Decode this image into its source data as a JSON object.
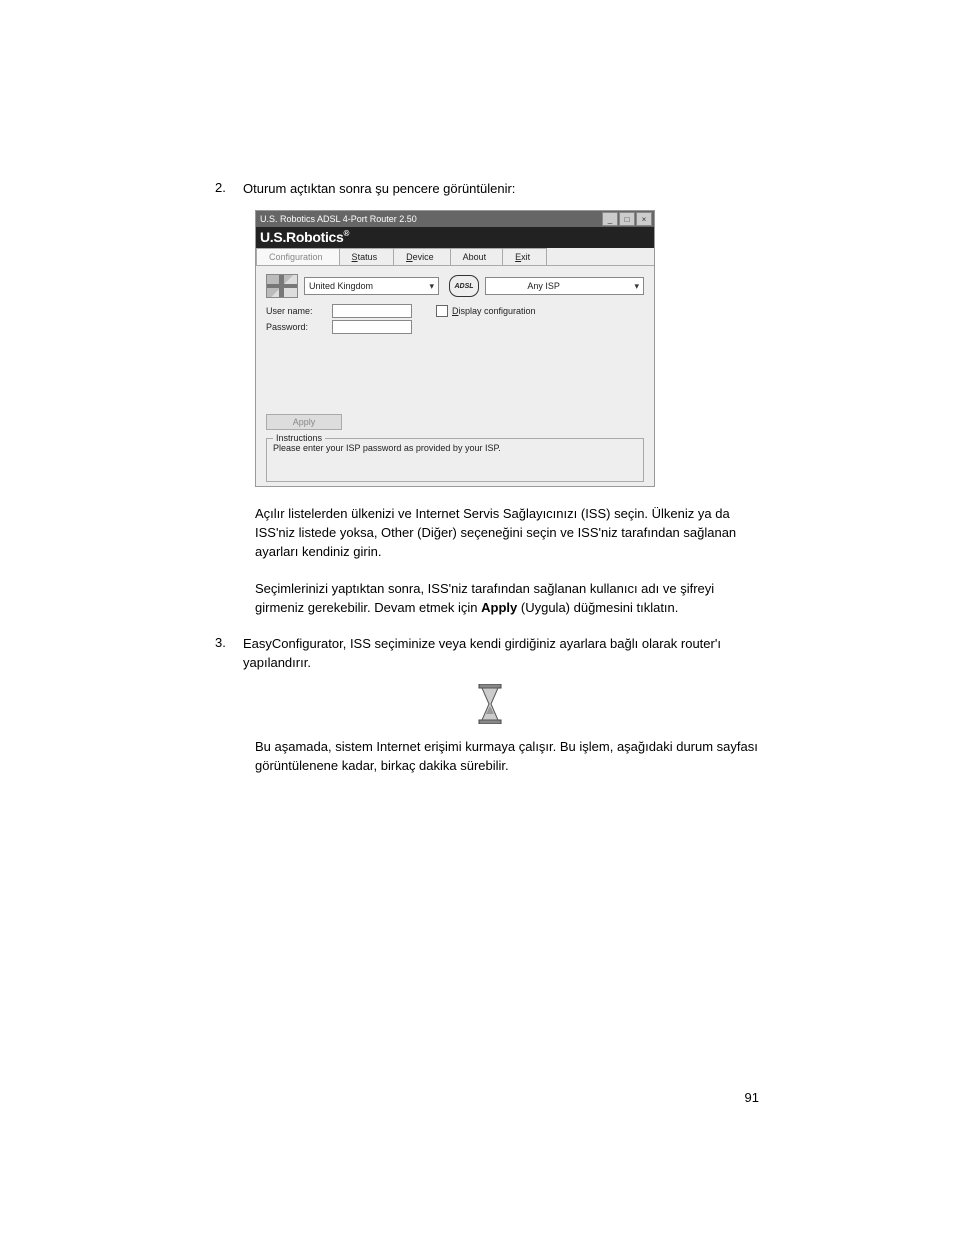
{
  "step2": {
    "num": "2.",
    "lead": "Oturum açtıktan sonra şu pencere görüntülenir:"
  },
  "window": {
    "title": "U.S. Robotics ADSL 4-Port Router 2.50",
    "brand": "U.S.Robotics",
    "brand_suffix": "®",
    "tabs": {
      "configuration": "Configuration",
      "status": "Status",
      "device": "Device",
      "about": "About",
      "exit": "Exit"
    },
    "country_select": "United Kingdom",
    "adsl_badge": "ADSL",
    "isp_select": "Any ISP",
    "labels": {
      "username": "User name:",
      "password": "Password:",
      "display_cfg": "Display configuration"
    },
    "apply": "Apply",
    "instructions_legend": "Instructions",
    "instructions_text": "Please enter your ISP password as provided by your ISP."
  },
  "para1": "Açılır listelerden ülkenizi ve Internet Servis Sağlayıcınızı (ISS) seçin. Ülkeniz ya da ISS'niz listede yoksa, Other (Diğer) seçeneğini seçin ve ISS'niz tarafından sağlanan ayarları kendiniz girin.",
  "para2_a": "Seçimlerinizi yaptıktan sonra, ISS'niz tarafından sağlanan kullanıcı adı ve şifreyi girmeniz gerekebilir. Devam etmek için ",
  "para2_bold": "Apply",
  "para2_b": " (Uygula) düğmesini tıklatın.",
  "step3": {
    "num": "3.",
    "lead": "EasyConfigurator, ISS seçiminize veya kendi girdiğiniz ayarlara bağlı olarak router'ı yapılandırır."
  },
  "para3": "Bu aşamada, sistem Internet erişimi kurmaya çalışır. Bu işlem, aşağıdaki durum sayfası görüntülenene kadar, birkaç dakika sürebilir.",
  "page_number": "91"
}
